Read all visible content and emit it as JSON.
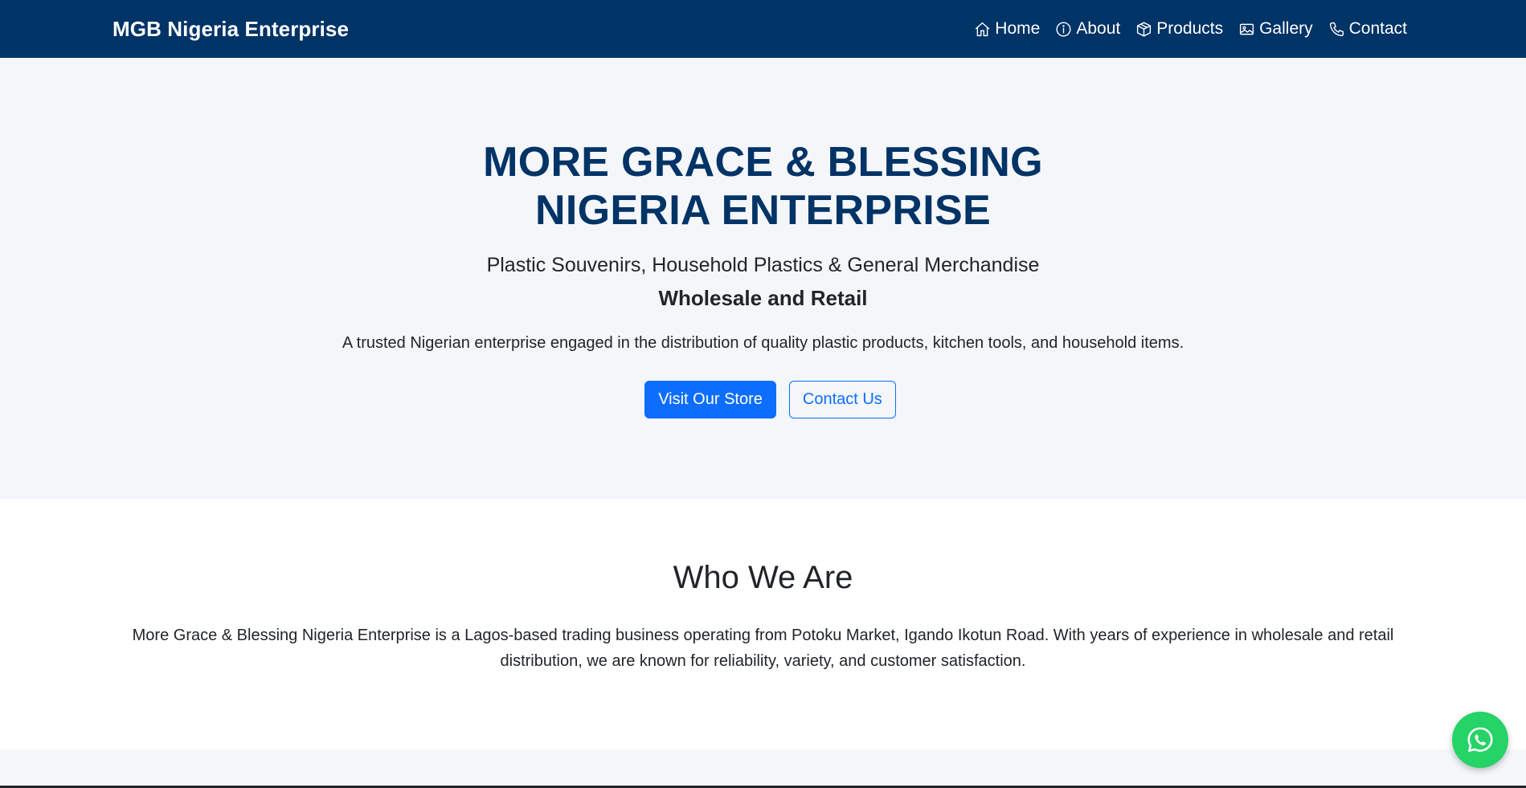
{
  "navbar": {
    "brand": "MGB Nigeria Enterprise",
    "links": [
      {
        "label": "Home",
        "icon": "home-icon"
      },
      {
        "label": "About",
        "icon": "info-icon"
      },
      {
        "label": "Products",
        "icon": "box-icon"
      },
      {
        "label": "Gallery",
        "icon": "image-icon"
      },
      {
        "label": "Contact",
        "icon": "phone-icon"
      }
    ]
  },
  "hero": {
    "title_line1": "MORE GRACE & BLESSING",
    "title_line2": "NIGERIA ENTERPRISE",
    "subtitle": "Plastic Souvenirs, Household Plastics & General Merchandise",
    "tagline": "Wholesale and Retail",
    "description": "A trusted Nigerian enterprise engaged in the distribution of quality plastic products, kitchen tools, and household items.",
    "primary_button": "Visit Our Store",
    "secondary_button": "Contact Us"
  },
  "about": {
    "title": "Who We Are",
    "text": "More Grace & Blessing Nigeria Enterprise is a Lagos-based trading business operating from Potoku Market, Igando Ikotun Road. With years of experience in wholesale and retail distribution, we are known for reliability, variety, and customer satisfaction."
  },
  "whatsapp": {
    "icon": "whatsapp-icon"
  },
  "colors": {
    "navbar_bg": "#003366",
    "hero_bg": "#f4f6f9",
    "title_color": "#003366",
    "primary": "#0d6efd",
    "whatsapp": "#25d366"
  }
}
